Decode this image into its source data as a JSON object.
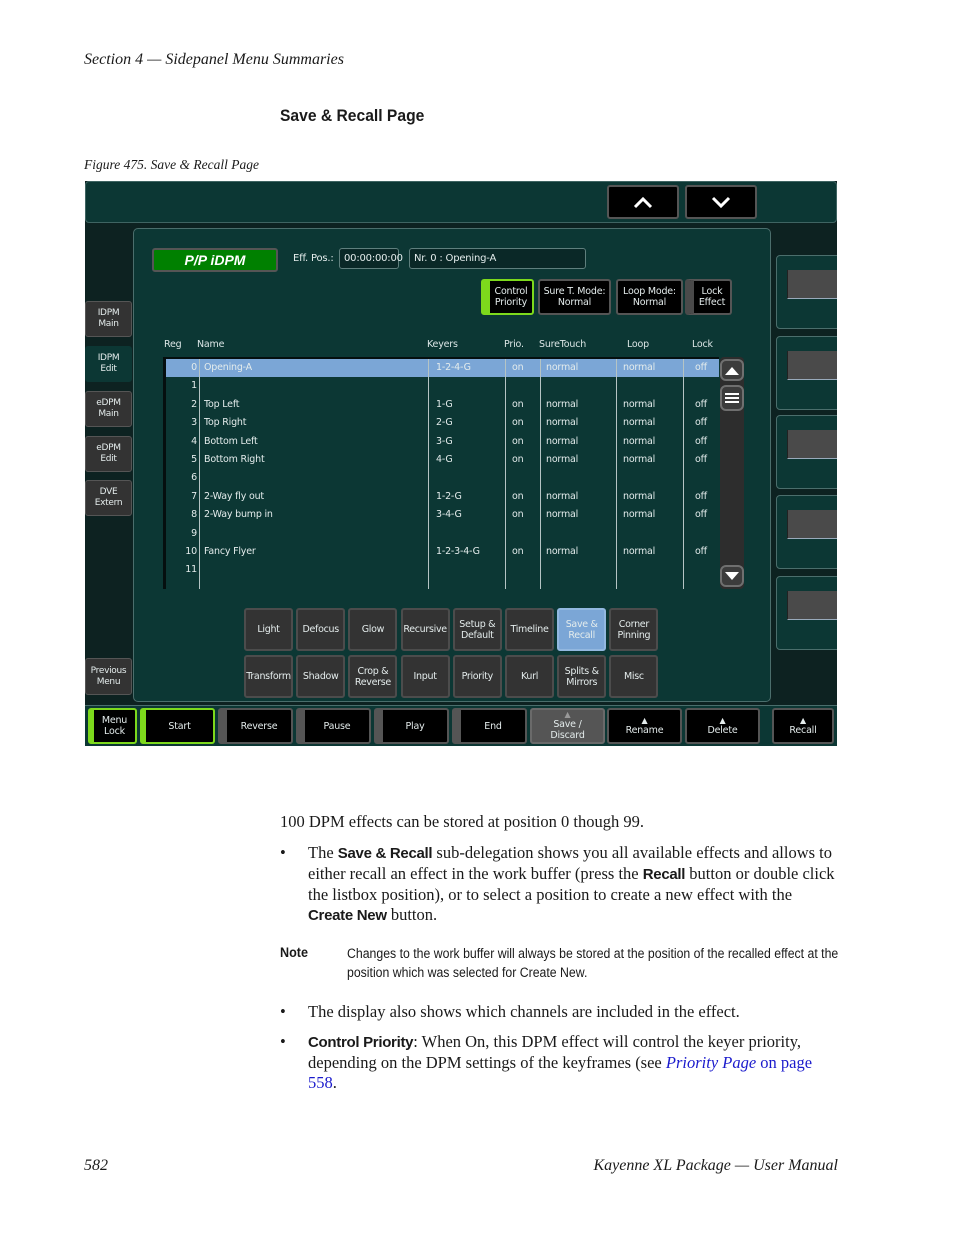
{
  "page": {
    "running_head": "Section 4 — Sidepanel Menu Summaries",
    "section_title": "Save & Recall Page",
    "figure_caption": "Figure 475.  Save & Recall Page",
    "footer_page_number": "582",
    "footer_title": "Kayenne XL Package  —  User Manual"
  },
  "ui": {
    "nav": {
      "up_icon": "chevron-up-icon",
      "down_icon": "chevron-down-icon"
    },
    "mode_label": "P/P iDPM",
    "eff_pos_label": "Eff. Pos.:",
    "eff_pos_value": "00:00:00:00",
    "effect_field": "Nr. 0 :  Opening-A",
    "options": [
      {
        "line1": "Control",
        "line2": "Priority",
        "active": true
      },
      {
        "line1": "Sure T. Mode:",
        "line2": "Normal",
        "active": false
      },
      {
        "line1": "Loop Mode:",
        "line2": "Normal",
        "active": false
      },
      {
        "line1": "Lock",
        "line2": "Effect",
        "active": false
      }
    ],
    "table": {
      "headers": [
        "Reg",
        "Name",
        "Keyers",
        "Prio.",
        "SureTouch",
        "Loop",
        "Lock"
      ],
      "rows": [
        {
          "reg": "0",
          "name": "Opening-A",
          "keyers": "1-2-4-G",
          "prio": "on",
          "suretouch": "normal",
          "loop": "normal",
          "lock": "off",
          "selected": true
        },
        {
          "reg": "1",
          "name": "",
          "keyers": "",
          "prio": "",
          "suretouch": "",
          "loop": "",
          "lock": ""
        },
        {
          "reg": "2",
          "name": "Top Left",
          "keyers": "1-G",
          "prio": "on",
          "suretouch": "normal",
          "loop": "normal",
          "lock": "off"
        },
        {
          "reg": "3",
          "name": "Top Right",
          "keyers": "2-G",
          "prio": "on",
          "suretouch": "normal",
          "loop": "normal",
          "lock": "off"
        },
        {
          "reg": "4",
          "name": "Bottom Left",
          "keyers": "3-G",
          "prio": "on",
          "suretouch": "normal",
          "loop": "normal",
          "lock": "off"
        },
        {
          "reg": "5",
          "name": "Bottom Right",
          "keyers": "4-G",
          "prio": "on",
          "suretouch": "normal",
          "loop": "normal",
          "lock": "off"
        },
        {
          "reg": "6",
          "name": "",
          "keyers": "",
          "prio": "",
          "suretouch": "",
          "loop": "",
          "lock": ""
        },
        {
          "reg": "7",
          "name": "2-Way fly out",
          "keyers": "1-2-G",
          "prio": "on",
          "suretouch": "normal",
          "loop": "normal",
          "lock": "off"
        },
        {
          "reg": "8",
          "name": "2-Way bump in",
          "keyers": "3-4-G",
          "prio": "on",
          "suretouch": "normal",
          "loop": "normal",
          "lock": "off"
        },
        {
          "reg": "9",
          "name": "",
          "keyers": "",
          "prio": "",
          "suretouch": "",
          "loop": "",
          "lock": ""
        },
        {
          "reg": "10",
          "name": "Fancy Flyer",
          "keyers": "1-2-3-4-G",
          "prio": "on",
          "suretouch": "normal",
          "loop": "normal",
          "lock": "off"
        },
        {
          "reg": "11",
          "name": "",
          "keyers": "",
          "prio": "",
          "suretouch": "",
          "loop": "",
          "lock": ""
        }
      ]
    },
    "categories_row1": [
      {
        "line1": "Light",
        "line2": ""
      },
      {
        "line1": "Defocus",
        "line2": ""
      },
      {
        "line1": "Glow",
        "line2": ""
      },
      {
        "line1": "Recursive",
        "line2": ""
      },
      {
        "line1": "Setup &",
        "line2": "Default"
      },
      {
        "line1": "Timeline",
        "line2": ""
      },
      {
        "line1": "Save &",
        "line2": "Recall",
        "active": true
      },
      {
        "line1": "Corner",
        "line2": "Pinning"
      }
    ],
    "categories_row2": [
      {
        "line1": "Transform",
        "line2": ""
      },
      {
        "line1": "Shadow",
        "line2": ""
      },
      {
        "line1": "Crop &",
        "line2": "Reverse"
      },
      {
        "line1": "Input",
        "line2": ""
      },
      {
        "line1": "Priority",
        "line2": ""
      },
      {
        "line1": "Kurl",
        "line2": ""
      },
      {
        "line1": "Splits &",
        "line2": "Mirrors"
      },
      {
        "line1": "Misc",
        "line2": ""
      }
    ],
    "side_tabs": [
      {
        "line1": "IDPM",
        "line2": "Main"
      },
      {
        "line1": "IDPM",
        "line2": "Edit",
        "active": true
      },
      {
        "line1": "eDPM",
        "line2": "Main"
      },
      {
        "line1": "eDPM",
        "line2": "Edit"
      },
      {
        "line1": "DVE",
        "line2": "Extern"
      }
    ],
    "previous_menu": {
      "line1": "Previous",
      "line2": "Menu"
    },
    "bottom_buttons": [
      {
        "line1": "Menu",
        "line2": "Lock"
      },
      {
        "line1": "Start",
        "line2": ""
      },
      {
        "line1": "Reverse",
        "line2": ""
      },
      {
        "line1": "Pause",
        "line2": ""
      },
      {
        "line1": "Play",
        "line2": ""
      },
      {
        "line1": "End",
        "line2": ""
      },
      {
        "line1": "Save /",
        "line2": "Discard"
      },
      {
        "line1": "Rename",
        "line2": ""
      },
      {
        "line1": "Delete",
        "line2": ""
      },
      {
        "line1": "Recall",
        "line2": ""
      }
    ],
    "colors": {
      "panel": "#0c3734",
      "active_green": "#7dd91c",
      "selection_blue": "#7ba6d6",
      "mode_green": "#008000"
    }
  },
  "body": {
    "intro": "100 DPM effects can be stored at position 0 though 99.",
    "bullet1": {
      "t1": "The ",
      "b1": "Save & Recall",
      "t2": " sub-delegation shows you all available effects and allows to either recall an effect in the work buffer (press the ",
      "b2": "Recall",
      "t3": " button or double click the listbox position), or to select a position to create a new effect with the ",
      "b3": "Create New",
      "t4": " button."
    },
    "note_label": "Note",
    "note_text": "Changes to the work buffer will always be stored at the position of the recalled effect at the position which was selected for Create New.",
    "bullet2": "The display also shows which channels are included in the effect.",
    "bullet3": {
      "b1": "Control Priority",
      "t1": ": When On, this DPM effect will control the keyer priority, depending on the DPM settings of the keyframes (see ",
      "link_italic": "Priority Page",
      "link_rest": " on page 558",
      "t2": "."
    },
    "bullet_glyph": "•"
  }
}
